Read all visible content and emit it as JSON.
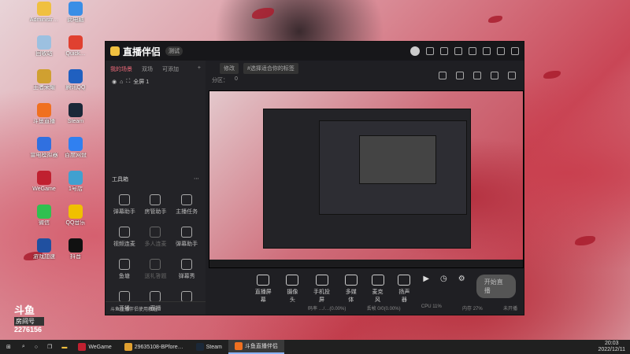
{
  "desktop": {
    "icons": [
      {
        "label": "Administr…",
        "color": "#f0c040"
      },
      {
        "label": "此电脑",
        "color": "#3a8ee6"
      },
      {
        "label": "回收站",
        "color": "#9cc0e0"
      },
      {
        "label": "Quick…",
        "color": "#e04030"
      },
      {
        "label": "王者荣耀",
        "color": "#d0a030"
      },
      {
        "label": "腾讯QQ",
        "color": "#2060c0"
      },
      {
        "label": "斗鱼直播",
        "color": "#f07020"
      },
      {
        "label": "Steam",
        "color": "#1b2838"
      },
      {
        "label": "雷电模拟器",
        "color": "#3070e0"
      },
      {
        "label": "百度网盘",
        "color": "#3080f0"
      },
      {
        "label": "WeGame",
        "color": "#c02030"
      },
      {
        "label": "1号店",
        "color": "#40a0d0"
      },
      {
        "label": "微信",
        "color": "#30c050"
      },
      {
        "label": "QQ音乐",
        "color": "#f0c000"
      },
      {
        "label": "游戏加速",
        "color": "#2050a0"
      },
      {
        "label": "抖音",
        "color": "#111111"
      }
    ],
    "douyu": {
      "logo": "斗鱼",
      "room_label": "房间号",
      "room_number": "2276156"
    }
  },
  "app": {
    "brand": "直播伴侣",
    "version": "测试",
    "scene_tabs": [
      "我的场景",
      "双场",
      "可添加"
    ],
    "scene_item": "全屏 1",
    "tools_title": "工具箱",
    "tools": [
      {
        "label": "弹幕助手",
        "dim": false
      },
      {
        "label": "房管助手",
        "dim": false
      },
      {
        "label": "主播任务",
        "dim": false
      },
      {
        "label": "视频连麦",
        "dim": false
      },
      {
        "label": "多人连麦",
        "dim": true
      },
      {
        "label": "弹幕助手",
        "dim": false
      },
      {
        "label": "鱼塘",
        "dim": false
      },
      {
        "label": "送礼答题",
        "dim": true
      },
      {
        "label": "弹幕秀",
        "dim": false
      },
      {
        "label": "开播",
        "dim": false
      },
      {
        "label": "直播",
        "dim": false
      },
      {
        "label": "",
        "dim": false
      }
    ],
    "footer_text": "斗鱼直播伴侣使用教程",
    "top_edit": "修改",
    "top_title": "#选择适合你的标签",
    "sub_left": "分区：",
    "sub_count": "0",
    "controls": [
      "直播屏幕",
      "摄像头",
      "手机投屏",
      "多媒体",
      "麦克风",
      "扬声器"
    ],
    "go_live": "开始直播",
    "status_left": "码率 …/…(0.00%)",
    "status_mid": "丢帧 0/0(0.00%)",
    "status_cpu": "CPU 11%",
    "status_mem": "内存 27%",
    "status_right": "未开播"
  },
  "taskbar": {
    "apps": [
      {
        "label": "WeGame",
        "color": "#c02030",
        "active": false
      },
      {
        "label": "29635108-BPfore…",
        "color": "#e0a030",
        "active": false
      },
      {
        "label": "Steam",
        "color": "#1b2838",
        "active": false
      },
      {
        "label": "斗鱼直播伴侣",
        "color": "#f07020",
        "active": true
      }
    ],
    "time": "20:03",
    "date": "2022/12/11"
  }
}
